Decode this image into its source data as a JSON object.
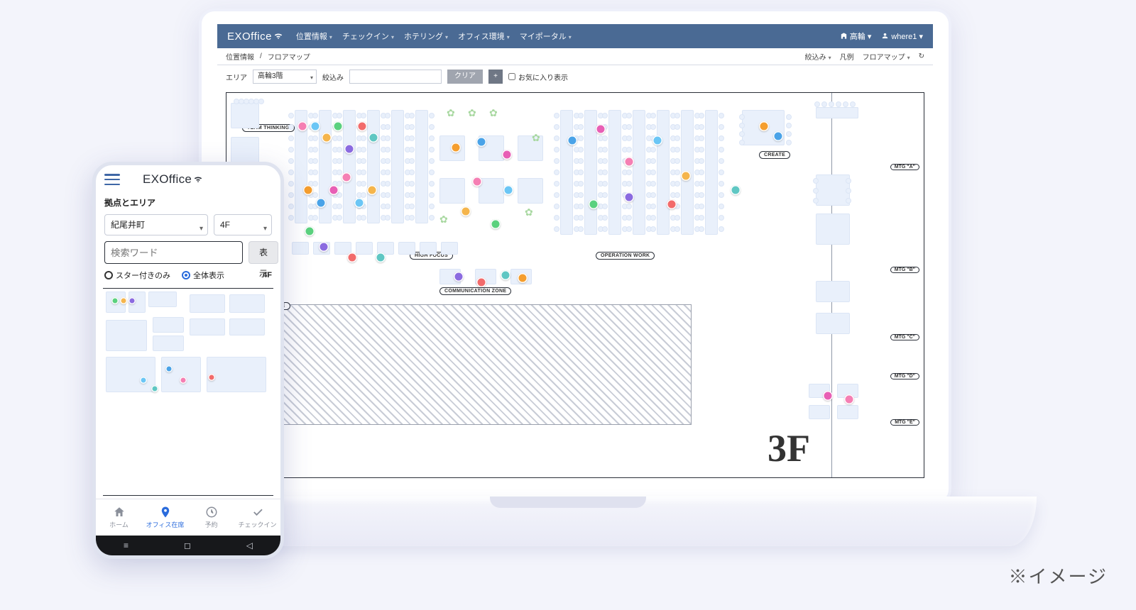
{
  "caption": "※イメージ",
  "desktop": {
    "brand": "EXOffice",
    "nav": [
      "位置情報",
      "チェックイン",
      "ホテリング",
      "オフィス環境",
      "マイポータル"
    ],
    "user_loc": "高輪",
    "user_name": "where1",
    "crumb1": "位置情報",
    "crumb_sep": "/",
    "crumb2": "フロアマップ",
    "crumb_right": [
      "絞込み",
      "凡例",
      "フロアマップ"
    ],
    "filter": {
      "area_label": "エリア",
      "area_value": "高輪3階",
      "search_label": "絞込み",
      "search_value": "",
      "clear": "クリア",
      "plus": "+",
      "fav": "お気に入り表示"
    },
    "floor_label": "3F",
    "zones": {
      "team": "TEAM THINKING",
      "high": "HIGH FOCUS",
      "comm": "COMMUNICATION ZONE",
      "op": "OPERATION WORK",
      "create": "CREATE",
      "zone": "ZONE"
    },
    "mtg": [
      "MTG \"A\"",
      "MTG \"B\"",
      "MTG \"C\"",
      "MTG \"D\"",
      "MTG \"E\""
    ]
  },
  "mobile": {
    "brand": "EXOffice",
    "section": "拠点とエリア",
    "loc": "紀尾井町",
    "floor": "4F",
    "search_placeholder": "検索ワード",
    "show": "表示",
    "radio_star": "スター付きのみ",
    "radio_all": "全体表示",
    "floor_label": "4F",
    "tabs": [
      {
        "label": "ホーム",
        "icon": "home"
      },
      {
        "label": "オフィス在席",
        "icon": "pin"
      },
      {
        "label": "予約",
        "icon": "clock"
      },
      {
        "label": "チェックイン",
        "icon": "check"
      }
    ]
  },
  "dot_colors": [
    "#f57fb3",
    "#6bc6f5",
    "#f5b54c",
    "#5bd17e",
    "#8b6be0",
    "#f26b6b",
    "#5fc7c3",
    "#f59e2e",
    "#4aa3e8",
    "#e85fb5"
  ]
}
